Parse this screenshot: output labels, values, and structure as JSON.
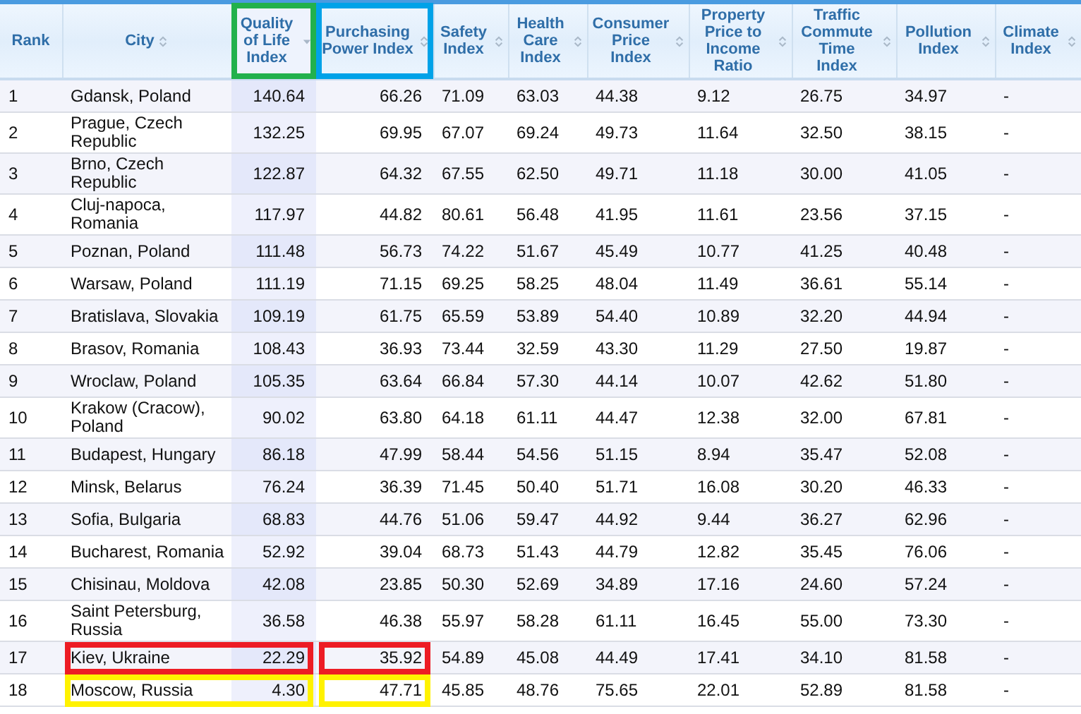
{
  "table": {
    "columns": [
      {
        "label": "Rank",
        "sortable": false,
        "sorted": false
      },
      {
        "label": "City",
        "sortable": true,
        "sorted": false
      },
      {
        "label": "Quality of Life Index",
        "sortable": true,
        "sorted": true,
        "color": "#22b14c"
      },
      {
        "label": "Purchasing Power Index",
        "sortable": true,
        "sorted": false,
        "color": "#00a2e8"
      },
      {
        "label": "Safety Index",
        "sortable": true,
        "sorted": false
      },
      {
        "label": "Health Care Index",
        "sortable": true,
        "sorted": false
      },
      {
        "label": "Consumer Price Index",
        "sortable": true,
        "sorted": false
      },
      {
        "label": "Property Price to Income Ratio",
        "sortable": true,
        "sorted": false
      },
      {
        "label": "Traffic Commute Time Index",
        "sortable": true,
        "sorted": false
      },
      {
        "label": "Pollution Index",
        "sortable": true,
        "sorted": false
      },
      {
        "label": "Climate Index",
        "sortable": true,
        "sorted": false
      }
    ],
    "rows": [
      {
        "cells": [
          "1",
          "Gdansk, Poland",
          "140.64",
          "66.26",
          "71.09",
          "63.03",
          "44.38",
          "9.12",
          "26.75",
          "34.97",
          "-"
        ]
      },
      {
        "cells": [
          "2",
          "Prague, Czech Republic",
          "132.25",
          "69.95",
          "67.07",
          "69.24",
          "49.73",
          "11.64",
          "32.50",
          "38.15",
          "-"
        ]
      },
      {
        "cells": [
          "3",
          "Brno, Czech Republic",
          "122.87",
          "64.32",
          "67.55",
          "62.50",
          "49.71",
          "11.18",
          "30.00",
          "41.05",
          "-"
        ]
      },
      {
        "cells": [
          "4",
          "Cluj-napoca, Romania",
          "117.97",
          "44.82",
          "80.61",
          "56.48",
          "41.95",
          "11.61",
          "23.56",
          "37.15",
          "-"
        ]
      },
      {
        "cells": [
          "5",
          "Poznan, Poland",
          "111.48",
          "56.73",
          "74.22",
          "51.67",
          "45.49",
          "10.77",
          "41.25",
          "40.48",
          "-"
        ]
      },
      {
        "cells": [
          "6",
          "Warsaw, Poland",
          "111.19",
          "71.15",
          "69.25",
          "58.25",
          "48.04",
          "11.49",
          "36.61",
          "55.14",
          "-"
        ]
      },
      {
        "cells": [
          "7",
          "Bratislava, Slovakia",
          "109.19",
          "61.75",
          "65.59",
          "53.89",
          "54.40",
          "10.89",
          "32.20",
          "44.94",
          "-"
        ]
      },
      {
        "cells": [
          "8",
          "Brasov, Romania",
          "108.43",
          "36.93",
          "73.44",
          "32.59",
          "43.30",
          "11.29",
          "27.50",
          "19.87",
          "-"
        ]
      },
      {
        "cells": [
          "9",
          "Wroclaw, Poland",
          "105.35",
          "63.64",
          "66.84",
          "57.30",
          "44.14",
          "10.07",
          "42.62",
          "51.80",
          "-"
        ]
      },
      {
        "cells": [
          "10",
          "Krakow (Cracow), Poland",
          "90.02",
          "63.80",
          "64.18",
          "61.11",
          "44.47",
          "12.38",
          "32.00",
          "67.81",
          "-"
        ]
      },
      {
        "cells": [
          "11",
          "Budapest, Hungary",
          "86.18",
          "47.99",
          "58.44",
          "54.56",
          "51.15",
          "8.94",
          "35.47",
          "52.08",
          "-"
        ]
      },
      {
        "cells": [
          "12",
          "Minsk, Belarus",
          "76.24",
          "36.39",
          "71.45",
          "50.40",
          "51.71",
          "16.08",
          "30.20",
          "46.33",
          "-"
        ]
      },
      {
        "cells": [
          "13",
          "Sofia, Bulgaria",
          "68.83",
          "44.76",
          "51.06",
          "59.47",
          "44.92",
          "9.44",
          "36.27",
          "62.96",
          "-"
        ]
      },
      {
        "cells": [
          "14",
          "Bucharest, Romania",
          "52.92",
          "39.04",
          "68.73",
          "51.43",
          "44.79",
          "12.82",
          "35.45",
          "76.06",
          "-"
        ]
      },
      {
        "cells": [
          "15",
          "Chisinau, Moldova",
          "42.08",
          "23.85",
          "50.30",
          "52.69",
          "34.89",
          "17.16",
          "24.60",
          "57.24",
          "-"
        ]
      },
      {
        "cells": [
          "16",
          "Saint Petersburg, Russia",
          "36.58",
          "46.38",
          "55.97",
          "58.28",
          "61.11",
          "16.45",
          "55.00",
          "73.30",
          "-"
        ]
      },
      {
        "cells": [
          "17",
          "Kiev, Ukraine",
          "22.29",
          "35.92",
          "54.89",
          "45.08",
          "44.49",
          "17.41",
          "34.10",
          "81.58",
          "-"
        ],
        "color": "#ed1c24"
      },
      {
        "cells": [
          "18",
          "Moscow, Russia",
          "4.30",
          "47.71",
          "45.85",
          "48.76",
          "75.65",
          "22.01",
          "52.89",
          "81.58",
          "-"
        ],
        "color": "#fff200"
      }
    ]
  }
}
